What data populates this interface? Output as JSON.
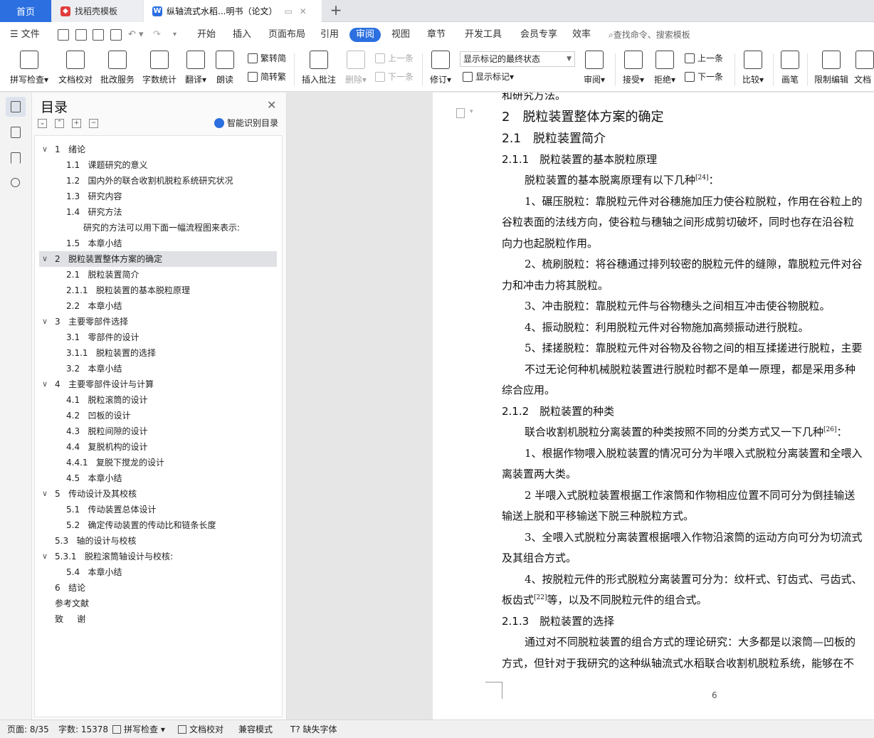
{
  "tabs": {
    "home": "首页",
    "templates": "找稻壳模板",
    "document": "纵轴流式水稻...明书（论文）"
  },
  "menu": {
    "file": "文件",
    "items": [
      "开始",
      "插入",
      "页面布局",
      "引用",
      "审阅",
      "视图",
      "章节",
      "开发工具",
      "会员专享",
      "效率"
    ],
    "active": "审阅",
    "search_placeholder": "查找命令、搜索模板"
  },
  "ribbon": {
    "spell_check": "拼写检查",
    "doc_proof": "文档校对",
    "batch_service": "批改服务",
    "word_count": "字数统计",
    "translate": "翻译",
    "read_aloud": "朗读",
    "trad_to_simp": "繁转简",
    "simp_to_trad": "简转繁",
    "insert_comment": "插入批注",
    "delete": "删除",
    "prev_comment": "上一条",
    "next_comment": "下一条",
    "revise": "修订",
    "markup_state": "显示标记的最终状态",
    "show_markup": "显示标记",
    "review": "审阅",
    "accept": "接受",
    "reject": "拒绝",
    "prev_change": "上一条",
    "next_change": "下一条",
    "compare": "比较",
    "pen": "画笔",
    "restrict_edit": "限制编辑",
    "doc_truncated": "文档"
  },
  "nav": {
    "title": "目录",
    "smart": "智能识别目录",
    "items": [
      {
        "num": "1",
        "text": "绪论",
        "level": 1,
        "chevron": true
      },
      {
        "num": "1.1",
        "text": "课题研究的意义",
        "level": 2
      },
      {
        "num": "1.2",
        "text": "国内外的联合收割机脱粒系统研究状况",
        "level": 2
      },
      {
        "num": "1.3",
        "text": "研究内容",
        "level": 2
      },
      {
        "num": "1.4",
        "text": "研究方法",
        "level": 2
      },
      {
        "num": "",
        "text": "研究的方法可以用下面一幅流程图来表示:",
        "level": 3
      },
      {
        "num": "1.5",
        "text": "本章小结",
        "level": 2
      },
      {
        "num": "2",
        "text": "脱粒装置整体方案的确定",
        "level": 1,
        "chevron": true,
        "selected": true
      },
      {
        "num": "2.1",
        "text": "脱粒装置简介",
        "level": 2
      },
      {
        "num": "2.1.1",
        "text": "脱粒装置的基本脱粒原理",
        "level": 2
      },
      {
        "num": "2.2",
        "text": "本章小结",
        "level": 2
      },
      {
        "num": "3",
        "text": "主要零部件选择",
        "level": 1,
        "chevron": true
      },
      {
        "num": "3.1",
        "text": "零部件的设计",
        "level": 2
      },
      {
        "num": "3.1.1",
        "text": "脱粒装置的选择",
        "level": 2
      },
      {
        "num": "3.2",
        "text": "本章小结",
        "level": 2
      },
      {
        "num": "4",
        "text": "主要零部件设计与计算",
        "level": 1,
        "chevron": true
      },
      {
        "num": "4.1",
        "text": "脱粒滚筒的设计",
        "level": 2
      },
      {
        "num": "4.2",
        "text": "凹板的设计",
        "level": 2
      },
      {
        "num": "4.3",
        "text": "脱粒间隙的设计",
        "level": 2
      },
      {
        "num": "4.4",
        "text": "复脱机构的设计",
        "level": 2
      },
      {
        "num": "4.4.1",
        "text": "复脱下搅龙的设计",
        "level": 2
      },
      {
        "num": "4.5",
        "text": "本章小结",
        "level": 2
      },
      {
        "num": "5",
        "text": "传动设计及其校核",
        "level": 1,
        "chevron": true
      },
      {
        "num": "5.1",
        "text": "传动装置总体设计",
        "level": 2
      },
      {
        "num": "5.2",
        "text": "确定传动装置的传动比和链条长度",
        "level": 2
      },
      {
        "num": "5.3",
        "text": "轴的设计与校核",
        "level": 0
      },
      {
        "num": "5.3.1",
        "text": "脱粒滚筒轴设计与校核:",
        "level": 1,
        "chevron": true
      },
      {
        "num": "5.4",
        "text": "本章小结",
        "level": 2
      },
      {
        "num": "6",
        "text": "结论",
        "level": 0
      },
      {
        "num": "",
        "text": "参考文献",
        "level": 0
      },
      {
        "num": "致",
        "text": "谢",
        "level": 0
      }
    ]
  },
  "document": {
    "lines": [
      {
        "text": "和研究方法。",
        "cls": ""
      },
      {
        "text": "2　脱粒装置整体方案的确定",
        "cls": "h1"
      },
      {
        "text": "2.1　脱粒装置简介",
        "cls": "h2"
      },
      {
        "text": "2.1.1　脱粒装置的基本脱粒原理",
        "cls": "h3"
      },
      {
        "text": "脱粒装置的基本脱离原理有以下几种",
        "sup": "[24]",
        "after": "：",
        "cls": "ind"
      },
      {
        "text": "1、碾压脱粒：靠脱粒元件对谷穗施加压力使谷粒脱粒，作用在谷粒上的",
        "cls": "ind"
      },
      {
        "text": "谷粒表面的法线方向，使谷粒与穗轴之间形成剪切破坏，同时也存在沿谷粒",
        "cls": ""
      },
      {
        "text": "向力也起脱粒作用。",
        "cls": ""
      },
      {
        "text": "2、梳刷脱粒：将谷穗通过排列较密的脱粒元件的缝隙，靠脱粒元件对谷",
        "cls": "ind"
      },
      {
        "text": "力和冲击力将其脱粒。",
        "cls": ""
      },
      {
        "text": "3、冲击脱粒：靠脱粒元件与谷物穗头之间相互冲击使谷物脱粒。",
        "cls": "ind"
      },
      {
        "text": "4、振动脱粒：利用脱粒元件对谷物施加高频振动进行脱粒。",
        "cls": "ind"
      },
      {
        "text": "5、揉搓脱粒：靠脱粒元件对谷物及谷物之间的相互揉搓进行脱粒，主要",
        "cls": "ind"
      },
      {
        "text": "不过无论何种机械脱粒装置进行脱粒时都不是单一原理，都是采用多种",
        "cls": "ind"
      },
      {
        "text": "综合应用。",
        "cls": ""
      },
      {
        "text": "2.1.2　脱粒装置的种类",
        "cls": "h3"
      },
      {
        "text": "联合收割机脱粒分离装置的种类按照不同的分类方式又一下几种",
        "sup": "[26]",
        "after": "：",
        "cls": "ind"
      },
      {
        "text": "1、根据作物喂入脱粒装置的情况可分为半喂入式脱粒分离装置和全喂入",
        "cls": "ind"
      },
      {
        "text": "离装置两大类。",
        "cls": ""
      },
      {
        "text": "2 半喂入式脱粒装置根据工作滚筒和作物相应位置不同可分为倒挂输送",
        "cls": "ind"
      },
      {
        "text": "输送上脱和平移输送下脱三种脱粒方式。",
        "cls": ""
      },
      {
        "text": "3、全喂入式脱粒分离装置根据喂入作物沿滚筒的运动方向可分为切流式",
        "cls": "ind"
      },
      {
        "text": "及其组合方式。",
        "cls": ""
      },
      {
        "text": "4、按脱粒元件的形式脱粒分离装置可分为：纹杆式、钉齿式、弓齿式、",
        "cls": "ind"
      },
      {
        "text": "板齿式",
        "sup": "[22]",
        "after": "等，以及不同脱粒元件的组合式。",
        "cls": ""
      },
      {
        "text": "2.1.3　脱粒装置的选择",
        "cls": "h3"
      },
      {
        "text": "通过对不同脱粒装置的组合方式的理论研究：大多都是以滚筒—凹板的",
        "cls": "ind"
      },
      {
        "text": "方式，但针对于我研究的这种纵轴流式水稻联合收割机脱粒系统，能够在不",
        "cls": ""
      }
    ],
    "page_number": "6"
  },
  "status": {
    "page": "页面: 8/35",
    "words": "字数: 15378",
    "spell": "拼写检查",
    "proof": "文档校对",
    "compat": "兼容模式",
    "missing_font": "缺失字体"
  }
}
